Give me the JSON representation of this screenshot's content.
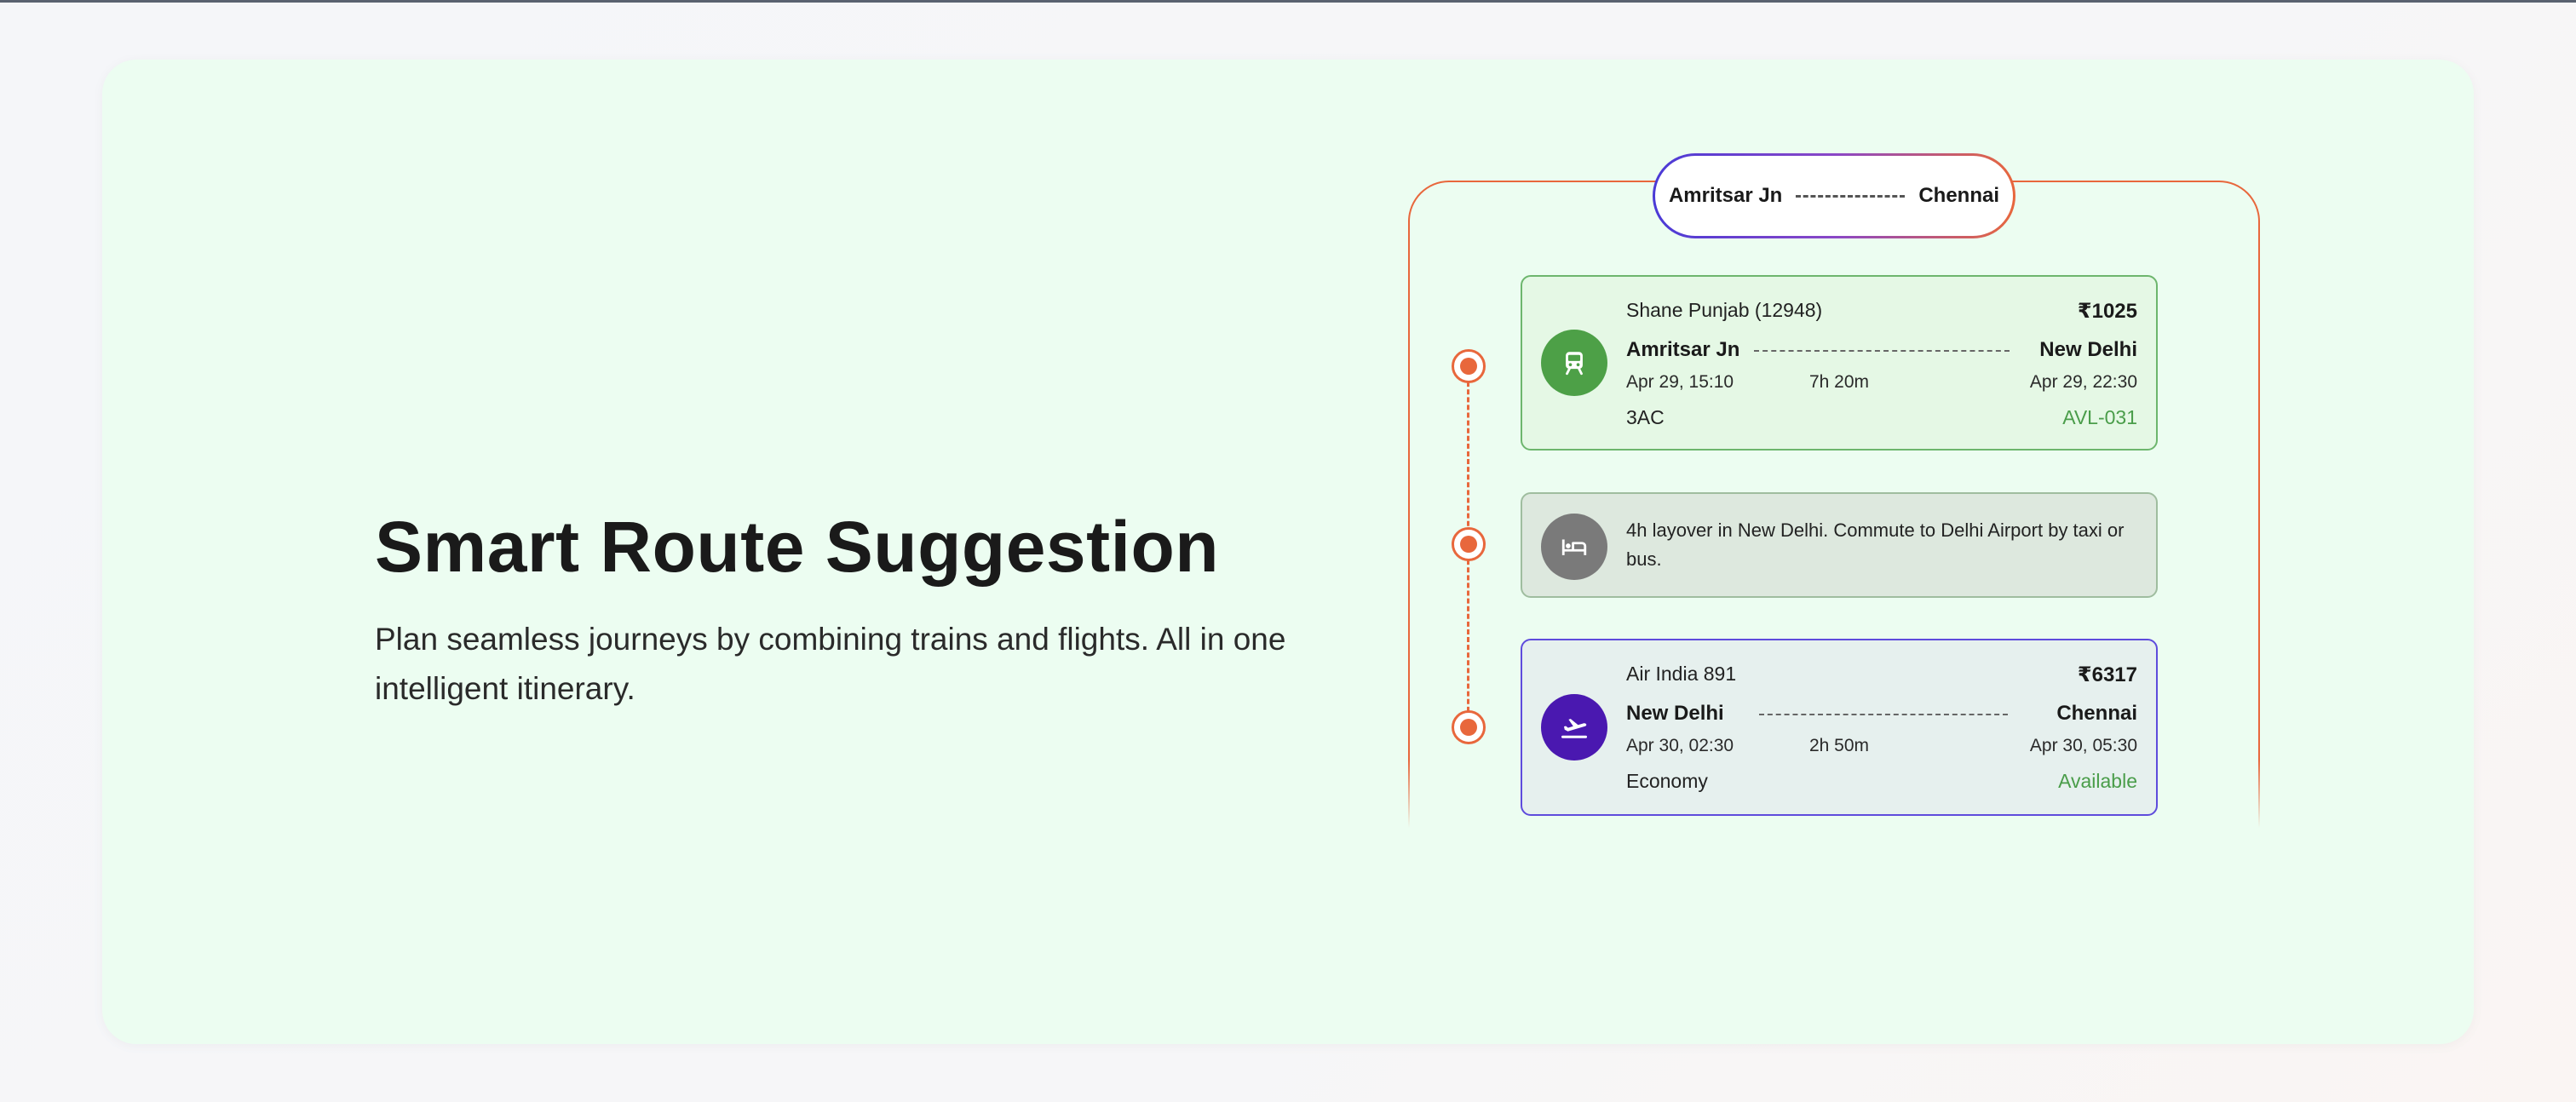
{
  "hero": {
    "title": "Smart Route Suggestion",
    "description": "Plan seamless journeys by combining trains and flights. All in one intelligent itinerary."
  },
  "route": {
    "origin": "Amritsar Jn",
    "destination": "Chennai",
    "legs": [
      {
        "type": "train",
        "icon": "train-icon",
        "name": "Shane Punjab (12948)",
        "price": "₹1025",
        "from": "Amritsar Jn",
        "to": "New Delhi",
        "depart": "Apr 29, 15:10",
        "duration": "7h 20m",
        "arrive": "Apr 29, 22:30",
        "class": "3AC",
        "status": "AVL-031"
      },
      {
        "type": "layover",
        "icon": "hotel-bed-icon",
        "text": "4h layover in New Delhi. Commute to Delhi Airport by taxi or bus."
      },
      {
        "type": "flight",
        "icon": "flight-takeoff-icon",
        "name": "Air India 891",
        "price": "₹6317",
        "from": "New Delhi",
        "to": "Chennai",
        "depart": "Apr 30, 02:30",
        "duration": "2h 50m",
        "arrive": "Apr 30, 05:30",
        "class": "Economy",
        "status": "Available"
      }
    ]
  },
  "colors": {
    "accent": "#e8673c",
    "train": "#4da047",
    "layover": "#7a7a7a",
    "flight": "#4a18b0",
    "available": "#4a9d4a",
    "hero_bg": "#ecfdf1"
  }
}
